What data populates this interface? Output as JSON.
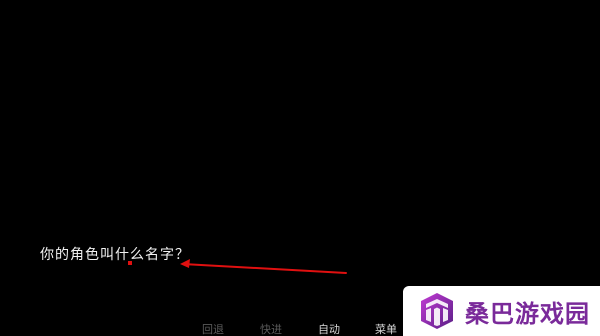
{
  "dialogue": {
    "text": "你的角色叫什么名字？"
  },
  "menu_bar": {
    "rollback": "回退",
    "skip": "快进",
    "auto": "自动",
    "menu": "菜单"
  },
  "annotation": {
    "arrow_color": "#e01010"
  },
  "watermark": {
    "site_name": "桑巴游戏园",
    "logo_icon": "sangba-logo-icon",
    "brand_color": "#7a2a9a"
  },
  "colors": {
    "background": "#000000",
    "dialogue_text": "#f2f2f2",
    "menu_dim": "#5a5a5a",
    "menu_lit": "#d8d8d8"
  }
}
